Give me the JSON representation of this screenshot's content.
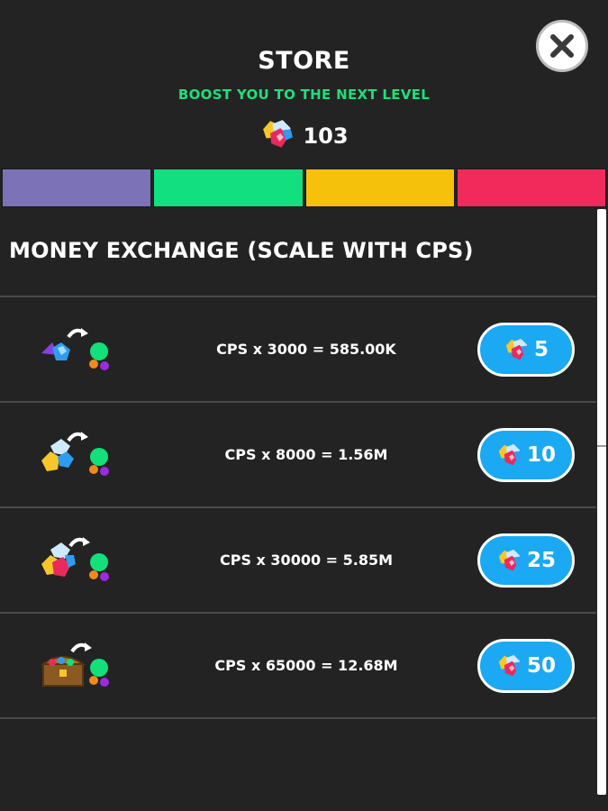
{
  "store": {
    "title": "STORE",
    "subtitle": "BOOST YOU TO THE NEXT LEVEL",
    "balance": "103",
    "balance_icon": "gems-icon",
    "close_icon": "close-icon"
  },
  "tabs": [
    {
      "color": "#7b72b8"
    },
    {
      "color": "#12df80"
    },
    {
      "color": "#f6c10a"
    },
    {
      "color": "#f22a5c"
    }
  ],
  "section": {
    "title": "MONEY EXCHANGE (SCALE WITH CPS)"
  },
  "items": [
    {
      "label": "CPS x 3000 = 585.00K",
      "price": "5",
      "icon": "small-gems-exchange-icon"
    },
    {
      "label": "CPS x 8000 = 1.56M",
      "price": "10",
      "icon": "gem-pile-exchange-icon"
    },
    {
      "label": "CPS x 30000 = 5.85M",
      "price": "25",
      "icon": "gem-bundle-exchange-icon"
    },
    {
      "label": "CPS x 65000 = 12.68M",
      "price": "50",
      "icon": "treasure-chest-exchange-icon"
    }
  ],
  "colors": {
    "accent": "#1aa9f2",
    "subtitle": "#1ee07a",
    "background": "#232323"
  }
}
